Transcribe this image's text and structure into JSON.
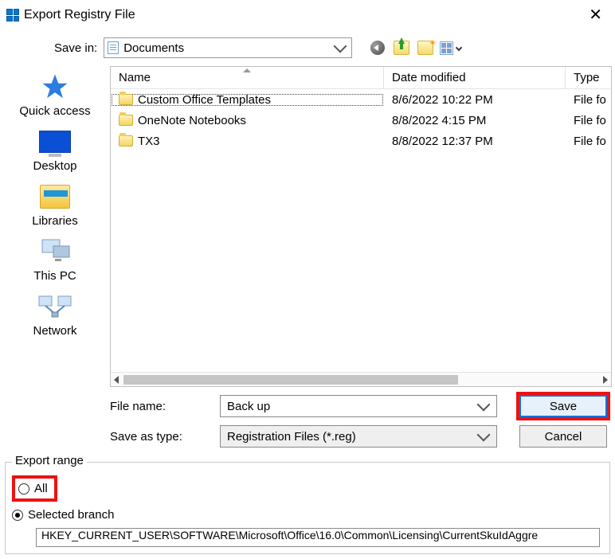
{
  "window": {
    "title": "Export Registry File"
  },
  "savein": {
    "label": "Save in:",
    "value": "Documents"
  },
  "toolbar": {
    "back": "back-icon",
    "up": "up-one-level-icon",
    "newfolder": "new-folder-icon",
    "viewmenu": "view-menu-icon"
  },
  "sidebar": {
    "items": [
      {
        "label": "Quick access"
      },
      {
        "label": "Desktop"
      },
      {
        "label": "Libraries"
      },
      {
        "label": "This PC"
      },
      {
        "label": "Network"
      }
    ]
  },
  "columns": {
    "name": "Name",
    "date": "Date modified",
    "type": "Type"
  },
  "files": [
    {
      "name": "Custom Office Templates",
      "date": "8/6/2022 10:22 PM",
      "type": "File fo"
    },
    {
      "name": "OneNote Notebooks",
      "date": "8/8/2022 4:15 PM",
      "type": "File fo"
    },
    {
      "name": "TX3",
      "date": "8/8/2022 12:37 PM",
      "type": "File fo"
    }
  ],
  "form": {
    "filename_label": "File name:",
    "filename_value": "Back up",
    "type_label": "Save as type:",
    "type_value": "Registration Files (*.reg)",
    "save": "Save",
    "cancel": "Cancel"
  },
  "export": {
    "legend": "Export range",
    "all": "All",
    "selected": "Selected branch",
    "branch": "HKEY_CURRENT_USER\\SOFTWARE\\Microsoft\\Office\\16.0\\Common\\Licensing\\CurrentSkuIdAggre"
  }
}
